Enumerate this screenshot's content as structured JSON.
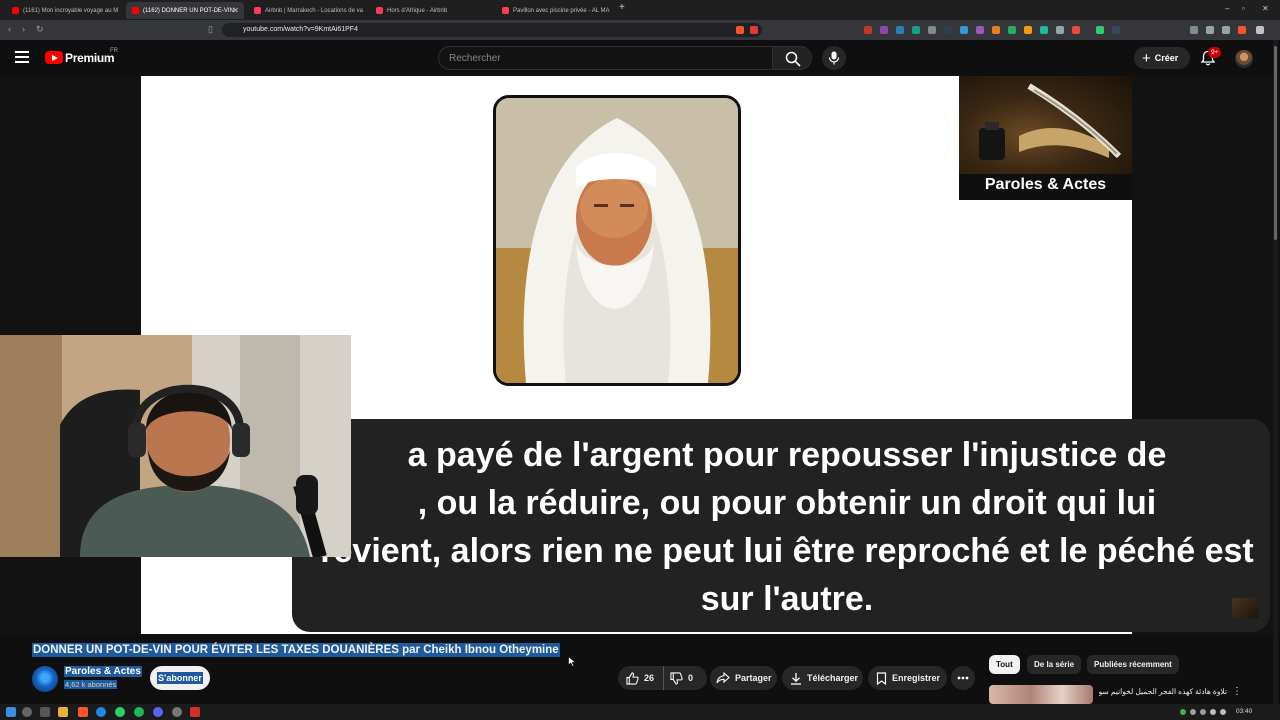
{
  "browser": {
    "tabs": [
      {
        "label": "(1161) Mon incroyable voyage au M",
        "favicon_color": "#ff0000"
      },
      {
        "label": "(1162) DONNER UN POT-DE-VIN",
        "favicon_color": "#ff0000"
      },
      {
        "label": "Airbnb | Marrakech - Locations de va",
        "favicon_color": "#ff385c"
      },
      {
        "label": "Hors d'Afrique - Airbnb",
        "favicon_color": "#ff385c"
      },
      {
        "label": "Pavillon avec piscine privée - AL MA",
        "favicon_color": "#ff385c"
      }
    ],
    "url": "youtube.com/watch?v=9KmtAi61PF4",
    "window_controls": [
      "–",
      "▫",
      "✕"
    ]
  },
  "masthead": {
    "brand": "Premium",
    "region": "FR",
    "search_placeholder": "Rechercher",
    "create_label": "Créer",
    "notification_badge": "9+",
    "icons": [
      "menu-icon",
      "search-icon",
      "mic-icon",
      "plus-icon",
      "bell-icon",
      "avatar"
    ]
  },
  "video": {
    "channel_card_title": "Paroles & Actes",
    "subtitle_lines": [
      "a payé de l'argent pour repousser l'injustice de",
      ", ou la réduire, ou pour obtenir un droit qui lui",
      "revient, alors rien ne peut lui être reproché et le péché est",
      "sur l'autre."
    ],
    "title": "DONNER UN POT-DE-VIN POUR ÉVITER LES TAXES DOUANIÈRES par Cheikh Ibnou Otheymine"
  },
  "channel": {
    "name": "Paroles & Actes",
    "subscribers": "4,62 k abonnés",
    "subscribe_label": "S'abonner"
  },
  "actions": {
    "likes": "26",
    "dislikes": "0",
    "share": "Partager",
    "download": "Télécharger",
    "save": "Enregistrer"
  },
  "chips": [
    "Tout",
    "De la série",
    "Publiées récemment"
  ],
  "recommendation": {
    "title": "تلاوة هادئة كهذه الفجر الجميل لخواتيم سورة"
  },
  "taskbar": {
    "clock": "03:40",
    "apps": [
      "windows-icon",
      "search-icon",
      "taskview-icon",
      "files-icon",
      "brave-icon",
      "whatsapp-icon",
      "edge-icon",
      "spotify-icon",
      "discord-icon",
      "steam-icon",
      "app-icon"
    ]
  },
  "colors": {
    "youtube_red": "#ff0000",
    "selection_blue": "#1f5a9c",
    "background": "#0f0f0f",
    "pill": "#272727"
  }
}
